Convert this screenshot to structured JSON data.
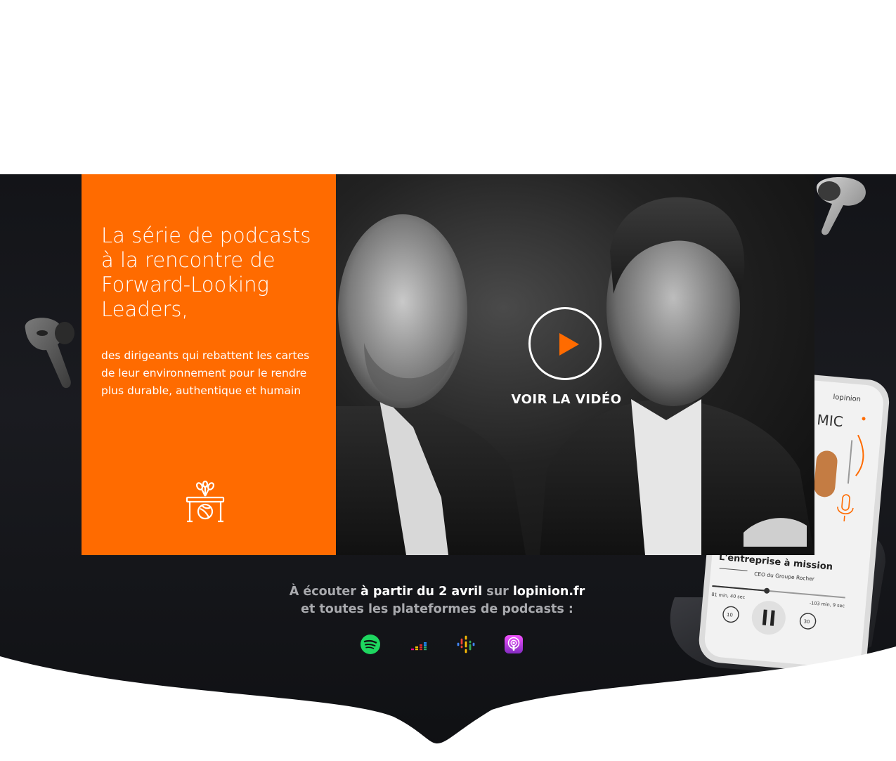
{
  "hero": {
    "title_lines": [
      "La série de podcasts",
      "à la rencontre de",
      "Forward-Looking",
      "Leaders,"
    ],
    "subtitle_lines": [
      "des dirigeants qui rebattent les cartes",
      "de leur environnement pour le rendre",
      "plus durable, authentique et humain"
    ],
    "icon": "podium-microphones-icon"
  },
  "video": {
    "label": "VOIR LA VIDÉO",
    "icon": "play-icon"
  },
  "phone": {
    "brand": "lopinion",
    "mic_label": "MIC",
    "episode_title": "L'entreprise à mission",
    "episode_sub": "CEO du Groupe Rocher",
    "elapsed": "81 min, 40 sec",
    "remaining": "-103 min, 9 sec",
    "skip_back": "10",
    "skip_forward": "30"
  },
  "listen": {
    "p1": "À écouter",
    "p2": "à partir du 2 avril",
    "p3": "sur",
    "p4": "lopinion.fr",
    "line2": "et toutes les plateformes de podcasts :"
  },
  "platforms": [
    {
      "name": "Spotify",
      "icon": "spotify-icon"
    },
    {
      "name": "Deezer",
      "icon": "deezer-icon"
    },
    {
      "name": "Google Podcasts",
      "icon": "google-podcasts-icon"
    },
    {
      "name": "Apple Podcasts",
      "icon": "apple-podcasts-icon"
    }
  ],
  "colors": {
    "accent": "#ff6b00",
    "banner_bg": "#16171b",
    "spotify": "#1ed760",
    "apple_podcasts": "#b150e2"
  }
}
